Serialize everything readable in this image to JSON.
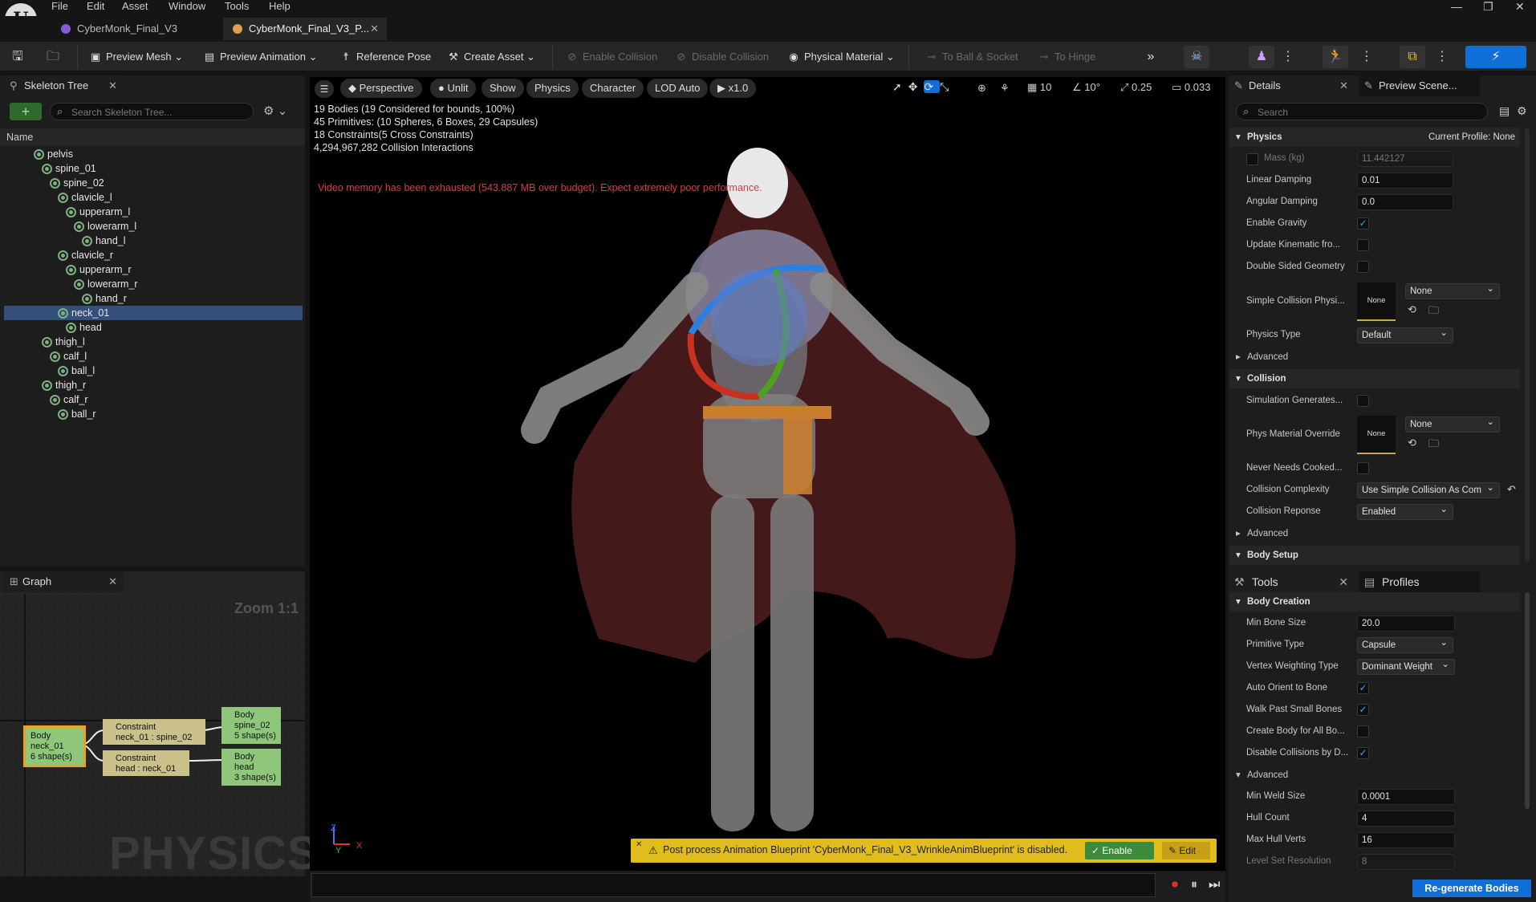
{
  "menu": [
    "File",
    "Edit",
    "Asset",
    "Window",
    "Tools",
    "Help"
  ],
  "doc_tabs": [
    {
      "label": "CyberMonk_Final_V3"
    },
    {
      "label": "CyberMonk_Final_V3_P..."
    }
  ],
  "toolbar": {
    "preview_mesh": "Preview Mesh",
    "preview_animation": "Preview Animation",
    "reference_pose": "Reference Pose",
    "create_asset": "Create Asset",
    "enable_collision": "Enable Collision",
    "disable_collision": "Disable Collision",
    "physical_material": "Physical Material",
    "to_ball_socket": "To Ball & Socket",
    "to_hinge": "To Hinge"
  },
  "skeleton_tree": {
    "tab": "Skeleton Tree",
    "search_placeholder": "Search Skeleton Tree...",
    "column": "Name",
    "bones": [
      {
        "name": "pelvis",
        "depth": 0
      },
      {
        "name": "spine_01",
        "depth": 1
      },
      {
        "name": "spine_02",
        "depth": 2
      },
      {
        "name": "clavicle_l",
        "depth": 3
      },
      {
        "name": "upperarm_l",
        "depth": 4
      },
      {
        "name": "lowerarm_l",
        "depth": 5
      },
      {
        "name": "hand_l",
        "depth": 6
      },
      {
        "name": "clavicle_r",
        "depth": 3
      },
      {
        "name": "upperarm_r",
        "depth": 4
      },
      {
        "name": "lowerarm_r",
        "depth": 5
      },
      {
        "name": "hand_r",
        "depth": 6
      },
      {
        "name": "neck_01",
        "depth": 3,
        "selected": true
      },
      {
        "name": "head",
        "depth": 4
      },
      {
        "name": "thigh_l",
        "depth": 1
      },
      {
        "name": "calf_l",
        "depth": 2
      },
      {
        "name": "ball_l",
        "depth": 3
      },
      {
        "name": "thigh_r",
        "depth": 1
      },
      {
        "name": "calf_r",
        "depth": 2
      },
      {
        "name": "ball_r",
        "depth": 3
      }
    ]
  },
  "graph": {
    "tab": "Graph",
    "zoom": "Zoom 1:1",
    "watermark": "PHYSICS",
    "nodes": {
      "body_neck": [
        "Body",
        "neck_01",
        "6 shape(s)"
      ],
      "constraint_1": [
        "Constraint",
        "neck_01 : spine_02"
      ],
      "constraint_2": [
        "Constraint",
        "head : neck_01"
      ],
      "body_spine": [
        "Body",
        "spine_02",
        "5 shape(s)"
      ],
      "body_head": [
        "Body",
        "head",
        "3 shape(s)"
      ]
    }
  },
  "viewport": {
    "perspective": "Perspective",
    "unlit": "Unlit",
    "show": "Show",
    "physics": "Physics",
    "character": "Character",
    "lod": "LOD Auto",
    "speed": "x1.0",
    "grid": "10",
    "angle": "10°",
    "scale": "0.25",
    "camera_speed": "0.033",
    "stats": [
      "19 Bodies (19 Considered for bounds, 100%)",
      "45 Primitives: (10 Spheres, 6 Boxes, 29 Capsules)",
      "18 Constraints(5 Cross Constraints)",
      "4,294,967,282 Collision Interactions"
    ],
    "warning": "Video memory has been exhausted (543.887 MB over budget). Expect extremely poor performance.",
    "notification": "Post process Animation Blueprint 'CyberMonk_Final_V3_WrinkleAnimBlueprint' is disabled.",
    "enable": "Enable",
    "edit": "Edit",
    "axis_x": "X",
    "axis_y": "Y",
    "axis_z": "Z"
  },
  "details": {
    "tab": "Details",
    "tab2": "Preview Scene...",
    "search_placeholder": "Search",
    "physics_header": "Physics",
    "current_profile": "Current Profile: None",
    "rows": {
      "mass_label": "Mass (kg)",
      "mass": "11.442127",
      "linear_label": "Linear Damping",
      "linear": "0.01",
      "angular_label": "Angular Damping",
      "angular": "0.0",
      "gravity_label": "Enable Gravity",
      "kinematic_label": "Update Kinematic fro...",
      "double_label": "Double Sided Geometry",
      "simple_label": "Simple Collision Physi...",
      "none": "None",
      "ptype_label": "Physics Type",
      "ptype": "Default",
      "advanced": "Advanced",
      "collision_header": "Collision",
      "simgen_label": "Simulation Generates...",
      "physmat_label": "Phys Material Override",
      "never_label": "Never Needs Cooked...",
      "complexity_label": "Collision Complexity",
      "complexity": "Use Simple Collision As Com",
      "response_label": "Collision Reponse",
      "response": "Enabled",
      "body_setup": "Body Setup"
    }
  },
  "tools": {
    "tab": "Tools",
    "tab2": "Profiles",
    "body_creation": "Body Creation",
    "min_bone_label": "Min Bone Size",
    "min_bone": "20.0",
    "prim_label": "Primitive Type",
    "prim": "Capsule",
    "vertex_label": "Vertex Weighting Type",
    "vertex": "Dominant Weight",
    "auto_label": "Auto Orient to Bone",
    "walk_label": "Walk Past Small Bones",
    "create_label": "Create Body for All Bo...",
    "disable_label": "Disable Collisions by D...",
    "advanced": "Advanced",
    "weld_label": "Min Weld Size",
    "weld": "0.0001",
    "hull_label": "Hull Count",
    "hull": "4",
    "verts_label": "Max Hull Verts",
    "verts": "16",
    "level_label": "Level Set Resolution",
    "level": "8",
    "regen": "Re-generate Bodies"
  },
  "colors": {
    "accent": "#0f6fd6",
    "selection": "#34507a",
    "warning": "#e0bd1d",
    "body_node": "#8fc77a",
    "constraint_node": "#c9c08a"
  }
}
